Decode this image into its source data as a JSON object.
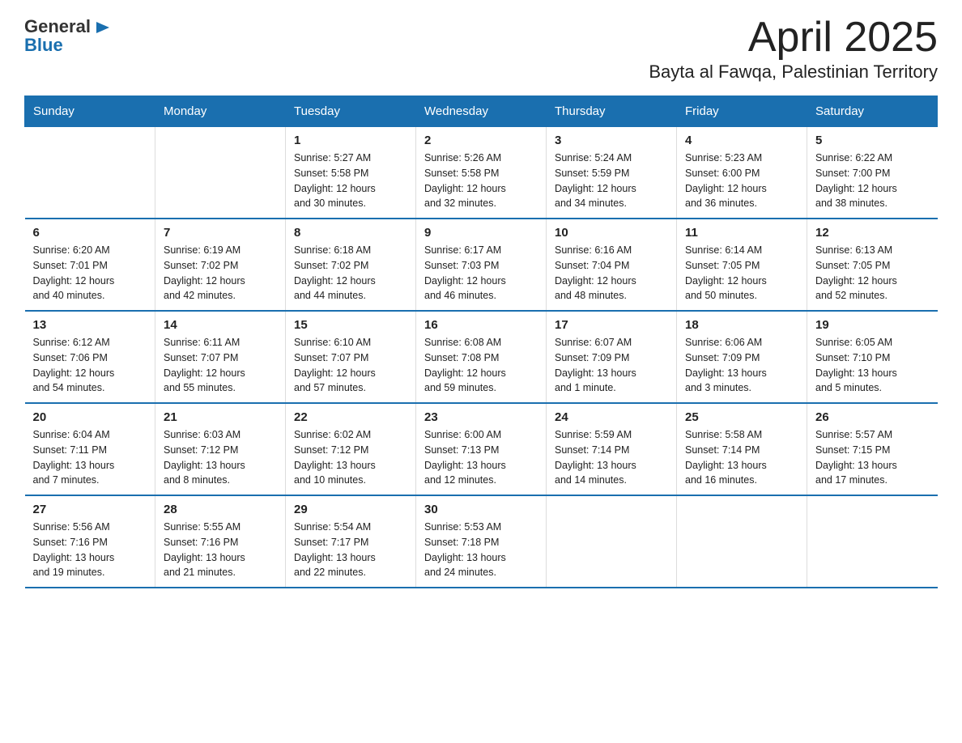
{
  "header": {
    "logo_general": "General",
    "logo_blue": "Blue",
    "title": "April 2025",
    "subtitle": "Bayta al Fawqa, Palestinian Territory"
  },
  "days_of_week": [
    "Sunday",
    "Monday",
    "Tuesday",
    "Wednesday",
    "Thursday",
    "Friday",
    "Saturday"
  ],
  "weeks": [
    [
      {
        "day": "",
        "info": ""
      },
      {
        "day": "",
        "info": ""
      },
      {
        "day": "1",
        "info": "Sunrise: 5:27 AM\nSunset: 5:58 PM\nDaylight: 12 hours\nand 30 minutes."
      },
      {
        "day": "2",
        "info": "Sunrise: 5:26 AM\nSunset: 5:58 PM\nDaylight: 12 hours\nand 32 minutes."
      },
      {
        "day": "3",
        "info": "Sunrise: 5:24 AM\nSunset: 5:59 PM\nDaylight: 12 hours\nand 34 minutes."
      },
      {
        "day": "4",
        "info": "Sunrise: 5:23 AM\nSunset: 6:00 PM\nDaylight: 12 hours\nand 36 minutes."
      },
      {
        "day": "5",
        "info": "Sunrise: 6:22 AM\nSunset: 7:00 PM\nDaylight: 12 hours\nand 38 minutes."
      }
    ],
    [
      {
        "day": "6",
        "info": "Sunrise: 6:20 AM\nSunset: 7:01 PM\nDaylight: 12 hours\nand 40 minutes."
      },
      {
        "day": "7",
        "info": "Sunrise: 6:19 AM\nSunset: 7:02 PM\nDaylight: 12 hours\nand 42 minutes."
      },
      {
        "day": "8",
        "info": "Sunrise: 6:18 AM\nSunset: 7:02 PM\nDaylight: 12 hours\nand 44 minutes."
      },
      {
        "day": "9",
        "info": "Sunrise: 6:17 AM\nSunset: 7:03 PM\nDaylight: 12 hours\nand 46 minutes."
      },
      {
        "day": "10",
        "info": "Sunrise: 6:16 AM\nSunset: 7:04 PM\nDaylight: 12 hours\nand 48 minutes."
      },
      {
        "day": "11",
        "info": "Sunrise: 6:14 AM\nSunset: 7:05 PM\nDaylight: 12 hours\nand 50 minutes."
      },
      {
        "day": "12",
        "info": "Sunrise: 6:13 AM\nSunset: 7:05 PM\nDaylight: 12 hours\nand 52 minutes."
      }
    ],
    [
      {
        "day": "13",
        "info": "Sunrise: 6:12 AM\nSunset: 7:06 PM\nDaylight: 12 hours\nand 54 minutes."
      },
      {
        "day": "14",
        "info": "Sunrise: 6:11 AM\nSunset: 7:07 PM\nDaylight: 12 hours\nand 55 minutes."
      },
      {
        "day": "15",
        "info": "Sunrise: 6:10 AM\nSunset: 7:07 PM\nDaylight: 12 hours\nand 57 minutes."
      },
      {
        "day": "16",
        "info": "Sunrise: 6:08 AM\nSunset: 7:08 PM\nDaylight: 12 hours\nand 59 minutes."
      },
      {
        "day": "17",
        "info": "Sunrise: 6:07 AM\nSunset: 7:09 PM\nDaylight: 13 hours\nand 1 minute."
      },
      {
        "day": "18",
        "info": "Sunrise: 6:06 AM\nSunset: 7:09 PM\nDaylight: 13 hours\nand 3 minutes."
      },
      {
        "day": "19",
        "info": "Sunrise: 6:05 AM\nSunset: 7:10 PM\nDaylight: 13 hours\nand 5 minutes."
      }
    ],
    [
      {
        "day": "20",
        "info": "Sunrise: 6:04 AM\nSunset: 7:11 PM\nDaylight: 13 hours\nand 7 minutes."
      },
      {
        "day": "21",
        "info": "Sunrise: 6:03 AM\nSunset: 7:12 PM\nDaylight: 13 hours\nand 8 minutes."
      },
      {
        "day": "22",
        "info": "Sunrise: 6:02 AM\nSunset: 7:12 PM\nDaylight: 13 hours\nand 10 minutes."
      },
      {
        "day": "23",
        "info": "Sunrise: 6:00 AM\nSunset: 7:13 PM\nDaylight: 13 hours\nand 12 minutes."
      },
      {
        "day": "24",
        "info": "Sunrise: 5:59 AM\nSunset: 7:14 PM\nDaylight: 13 hours\nand 14 minutes."
      },
      {
        "day": "25",
        "info": "Sunrise: 5:58 AM\nSunset: 7:14 PM\nDaylight: 13 hours\nand 16 minutes."
      },
      {
        "day": "26",
        "info": "Sunrise: 5:57 AM\nSunset: 7:15 PM\nDaylight: 13 hours\nand 17 minutes."
      }
    ],
    [
      {
        "day": "27",
        "info": "Sunrise: 5:56 AM\nSunset: 7:16 PM\nDaylight: 13 hours\nand 19 minutes."
      },
      {
        "day": "28",
        "info": "Sunrise: 5:55 AM\nSunset: 7:16 PM\nDaylight: 13 hours\nand 21 minutes."
      },
      {
        "day": "29",
        "info": "Sunrise: 5:54 AM\nSunset: 7:17 PM\nDaylight: 13 hours\nand 22 minutes."
      },
      {
        "day": "30",
        "info": "Sunrise: 5:53 AM\nSunset: 7:18 PM\nDaylight: 13 hours\nand 24 minutes."
      },
      {
        "day": "",
        "info": ""
      },
      {
        "day": "",
        "info": ""
      },
      {
        "day": "",
        "info": ""
      }
    ]
  ]
}
